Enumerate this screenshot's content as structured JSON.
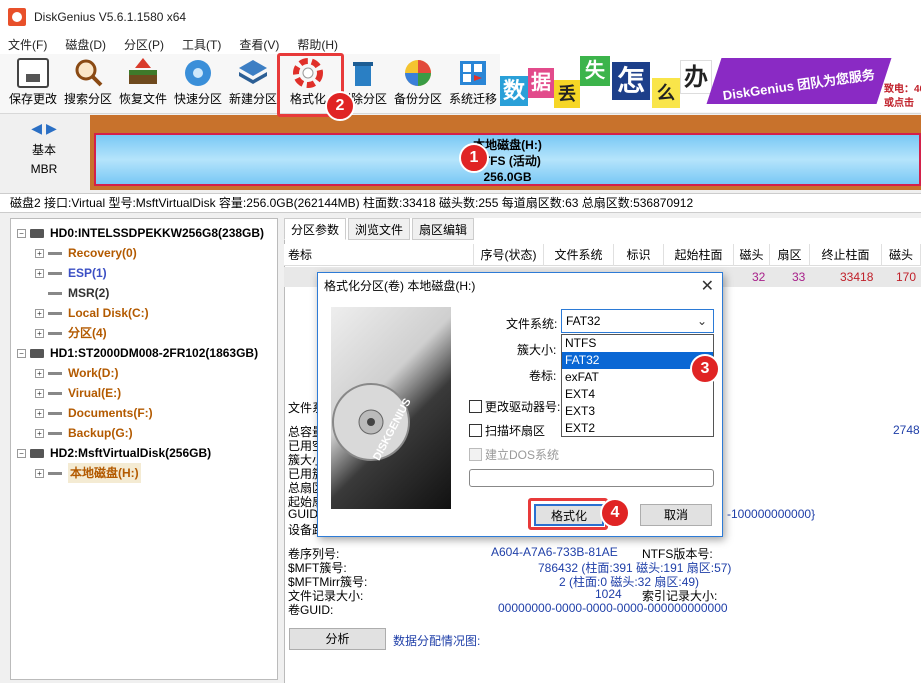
{
  "window": {
    "title": "DiskGenius V5.6.1.1580 x64"
  },
  "menu": [
    "文件(F)",
    "磁盘(D)",
    "分区(P)",
    "工具(T)",
    "查看(V)",
    "帮助(H)"
  ],
  "toolbar": [
    {
      "label": "保存更改",
      "icon": "save-icon"
    },
    {
      "label": "搜索分区",
      "icon": "search-icon"
    },
    {
      "label": "恢复文件",
      "icon": "recover-icon"
    },
    {
      "label": "快速分区",
      "icon": "quick-partition-icon"
    },
    {
      "label": "新建分区",
      "icon": "new-partition-icon"
    },
    {
      "label": "格式化",
      "icon": "format-icon"
    },
    {
      "label": "删除分区",
      "icon": "delete-icon"
    },
    {
      "label": "备份分区",
      "icon": "backup-icon"
    },
    {
      "label": "系统迁移",
      "icon": "migrate-icon"
    }
  ],
  "banner": {
    "chars": [
      "数",
      "据",
      "丢",
      "失",
      "怎",
      "么",
      "办"
    ],
    "bubble": "DiskGenius 团队为您服务",
    "tel_label": "致电：40",
    "click_label": "或点击"
  },
  "disk_nav": {
    "line1": "基本",
    "line2": "MBR"
  },
  "partition_bar": {
    "name": "本地磁盘(H:)",
    "fs": "NTFS (活动)",
    "size": "256.0GB"
  },
  "disk_info": "磁盘2 接口:Virtual  型号:MsftVirtualDisk  容量:256.0GB(262144MB)  柱面数:33418  磁头数:255  每道扇区数:63  总扇区数:536870912",
  "tree": [
    {
      "label": "HD0:INTELSSDPEKKW256G8(238GB)",
      "type": "disk",
      "level": 0
    },
    {
      "label": "Recovery(0)",
      "type": "part",
      "level": 1,
      "color": "#b35a00"
    },
    {
      "label": "ESP(1)",
      "type": "part",
      "level": 1,
      "color": "#3b4fc4"
    },
    {
      "label": "MSR(2)",
      "type": "part",
      "level": 1,
      "color": "#333333"
    },
    {
      "label": "Local Disk(C:)",
      "type": "part",
      "level": 1,
      "color": "#b35a00"
    },
    {
      "label": "分区(4)",
      "type": "part",
      "level": 1,
      "color": "#b35a00"
    },
    {
      "label": "HD1:ST2000DM008-2FR102(1863GB)",
      "type": "disk",
      "level": 0
    },
    {
      "label": "Work(D:)",
      "type": "part",
      "level": 1,
      "color": "#b35a00"
    },
    {
      "label": "Virual(E:)",
      "type": "part",
      "level": 1,
      "color": "#b35a00"
    },
    {
      "label": "Documents(F:)",
      "type": "part",
      "level": 1,
      "color": "#b35a00"
    },
    {
      "label": "Backup(G:)",
      "type": "part",
      "level": 1,
      "color": "#b35a00"
    },
    {
      "label": "HD2:MsftVirtualDisk(256GB)",
      "type": "disk",
      "level": 0
    },
    {
      "label": "本地磁盘(H:)",
      "type": "part",
      "level": 1,
      "color": "#b35a00",
      "selected": true
    }
  ],
  "tabs": [
    "分区参数",
    "浏览文件",
    "扇区编辑"
  ],
  "columns": [
    "卷标",
    "序号(状态)",
    "文件系统",
    "标识",
    "起始柱面",
    "磁头",
    "扇区",
    "终止柱面",
    "磁头"
  ],
  "row": {
    "head": "32",
    "sector": "33",
    "end_cyl": "33418",
    "end_head": "170"
  },
  "details_left": [
    "文件系",
    "总容量",
    "已用空",
    "簇大小",
    "已用簇",
    "总扇区",
    "起始扇",
    "GUID",
    "设备路"
  ],
  "details_right": {
    "value": "2748",
    "guid_tail": "-100000000000}"
  },
  "ntfs_info": [
    {
      "label": "卷序列号:",
      "value": "A604-A7A6-733B-81AE",
      "label2": "NTFS版本号:",
      "value2": ""
    },
    {
      "label": "$MFT簇号:",
      "value": "786432 (柱面:391 磁头:191 扇区:57)",
      "label2": "",
      "value2": ""
    },
    {
      "label": "$MFTMirr簇号:",
      "value": "2 (柱面:0 磁头:32 扇区:49)",
      "label2": "",
      "value2": ""
    },
    {
      "label": "文件记录大小:",
      "value": "1024",
      "label2": "索引记录大小:",
      "value2": ""
    },
    {
      "label": "卷GUID:",
      "value": "00000000-0000-0000-0000-000000000000",
      "label2": "",
      "value2": ""
    }
  ],
  "analyze": {
    "button": "分析",
    "label": "数据分配情况图:"
  },
  "dialog": {
    "title": "格式化分区(卷) 本地磁盘(H:)",
    "fs_label": "文件系统:",
    "cluster_label": "簇大小:",
    "volume_label": "卷标:",
    "fs_selected": "FAT32",
    "fs_options": [
      "NTFS",
      "FAT32",
      "exFAT",
      "EXT4",
      "EXT3",
      "EXT2"
    ],
    "change_drive_letter": "更改驱动器号:",
    "scan_bad": "扫描坏扇区",
    "build_dos": "建立DOS系统",
    "format_btn": "格式化",
    "cancel_btn": "取消",
    "image_brand": "DISKGENIUS"
  },
  "steps": [
    "1",
    "2",
    "3",
    "4"
  ]
}
